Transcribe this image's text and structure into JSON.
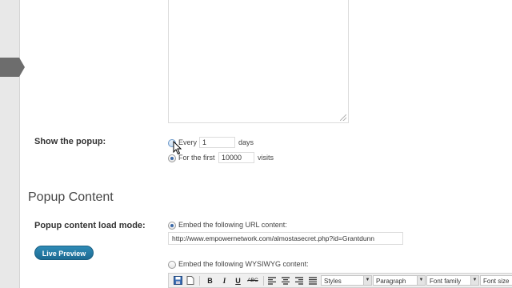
{
  "show_popup": {
    "label": "Show the popup:",
    "option_every": {
      "prefix": "Every",
      "value": "1",
      "suffix": "days"
    },
    "option_first": {
      "prefix": "For the first",
      "value": "10000",
      "suffix": "visits"
    }
  },
  "popup_content": {
    "section_title": "Popup Content",
    "load_mode_label": "Popup content load mode:",
    "live_preview_label": "Live Preview",
    "url_option_label": "Embed the following URL content:",
    "url_value": "http://www.empowernetwork.com/almostasecret.php?id=Grantdunn",
    "wysiwyg_option_label": "Embed the following WYSIWYG content:"
  },
  "editor_toolbar": {
    "bold": "B",
    "italic": "I",
    "underline": "U",
    "strike": "ABC",
    "styles": "Styles",
    "format": "Paragraph",
    "font_family": "Font family",
    "font_size": "Font size"
  },
  "icons": [
    "save-icon",
    "new-document-icon",
    "align-left-icon",
    "align-center-icon",
    "align-right-icon",
    "align-justify-icon",
    "resize-grip-icon",
    "mouse-cursor-icon"
  ]
}
